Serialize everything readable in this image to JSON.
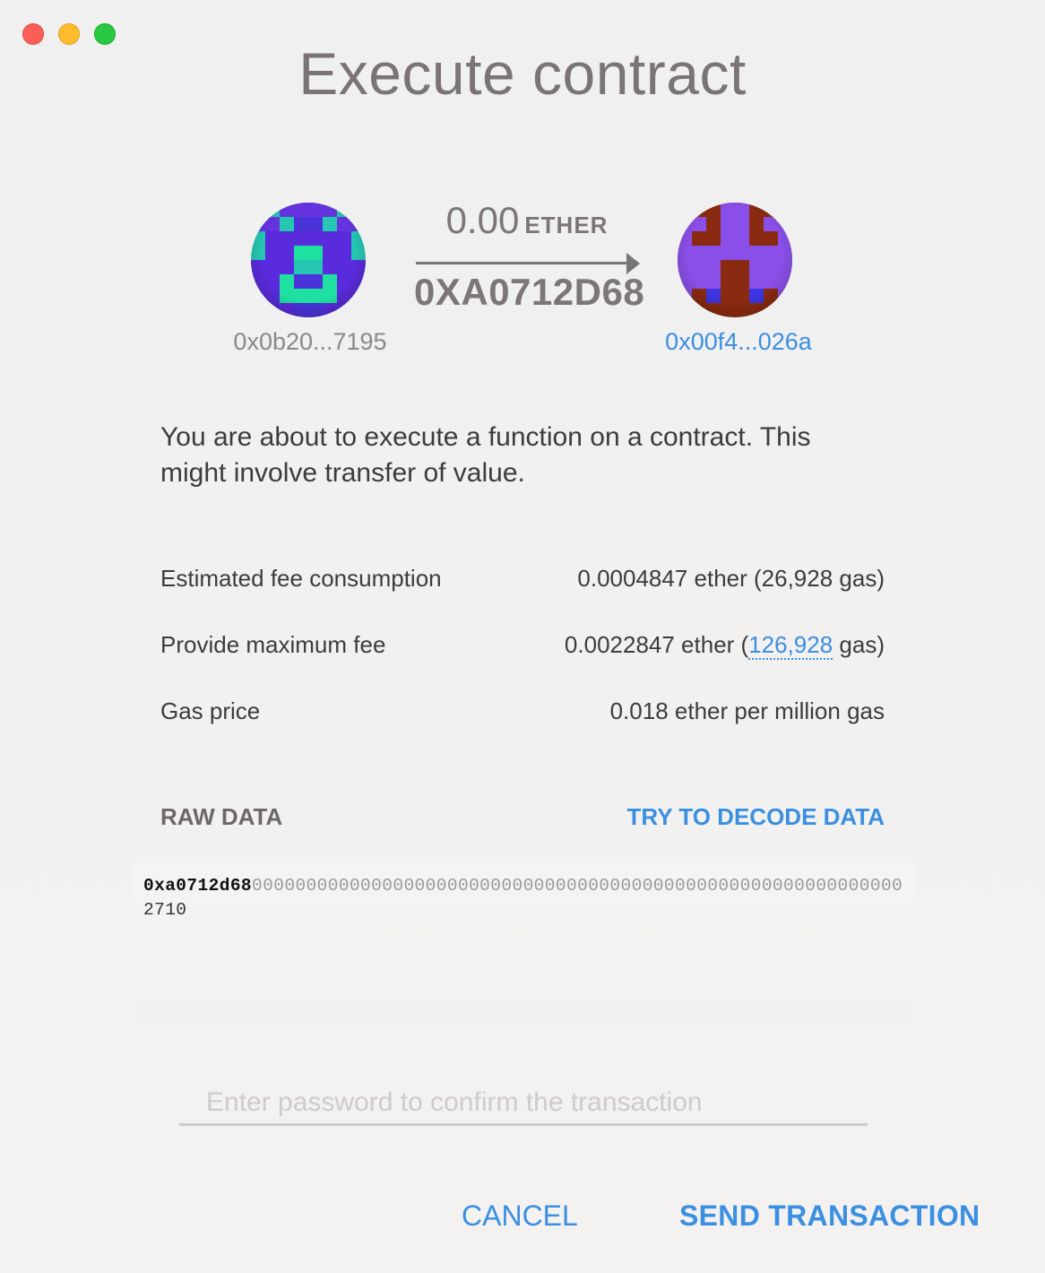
{
  "window": {
    "title": "Execute contract"
  },
  "transfer": {
    "from_address": "0x0b20...7195",
    "to_address": "0x00f4...026a",
    "amount": "0.00",
    "unit": "ETHER",
    "function_name": "0XA0712D68"
  },
  "description": "You are about to execute a function on a contract. This might involve transfer of value.",
  "fees": {
    "estimated_label": "Estimated fee consumption",
    "estimated_value": "0.0004847 ether (26,928 gas)",
    "max_label": "Provide maximum fee",
    "max_prefix": "0.0022847 ether (",
    "max_gas": "126,928",
    "max_suffix": " gas)",
    "price_label": "Gas price",
    "price_value": "0.018 ether per million gas"
  },
  "raw_data": {
    "label": "RAW DATA",
    "decode_label": "TRY TO DECODE DATA",
    "selector": "0xa0712d68",
    "zeros": "000000000000000000000000000000000000000000000000000000000000",
    "tail": "2710"
  },
  "password": {
    "placeholder": "Enter password to confirm the transaction",
    "value": ""
  },
  "buttons": {
    "cancel": "CANCEL",
    "send": "SEND TRANSACTION"
  },
  "colors": {
    "accent": "#3b8fe0",
    "muted": "#7c7676"
  },
  "icons": {
    "from_avatar": "identicon-blue-green",
    "to_avatar": "identicon-red-purple"
  }
}
